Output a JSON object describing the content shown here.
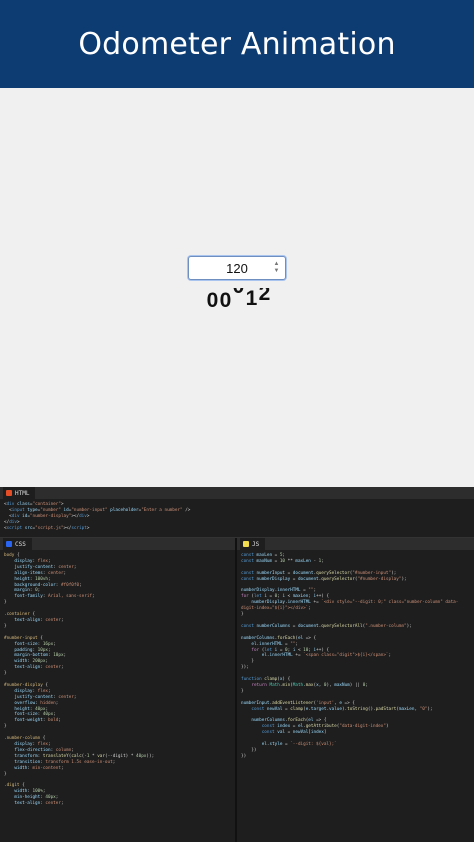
{
  "header": {
    "title": "Odometer Animation"
  },
  "preview": {
    "input_value": "120",
    "odometer_digits": [
      "0",
      "0",
      "0",
      "1",
      "2"
    ]
  },
  "editor": {
    "html_tab": "HTML",
    "css_tab": "CSS",
    "js_tab": "JS",
    "colors": {
      "html_icon": "#e44d26",
      "css_icon": "#2965f1",
      "js_icon": "#f0db4f"
    }
  }
}
